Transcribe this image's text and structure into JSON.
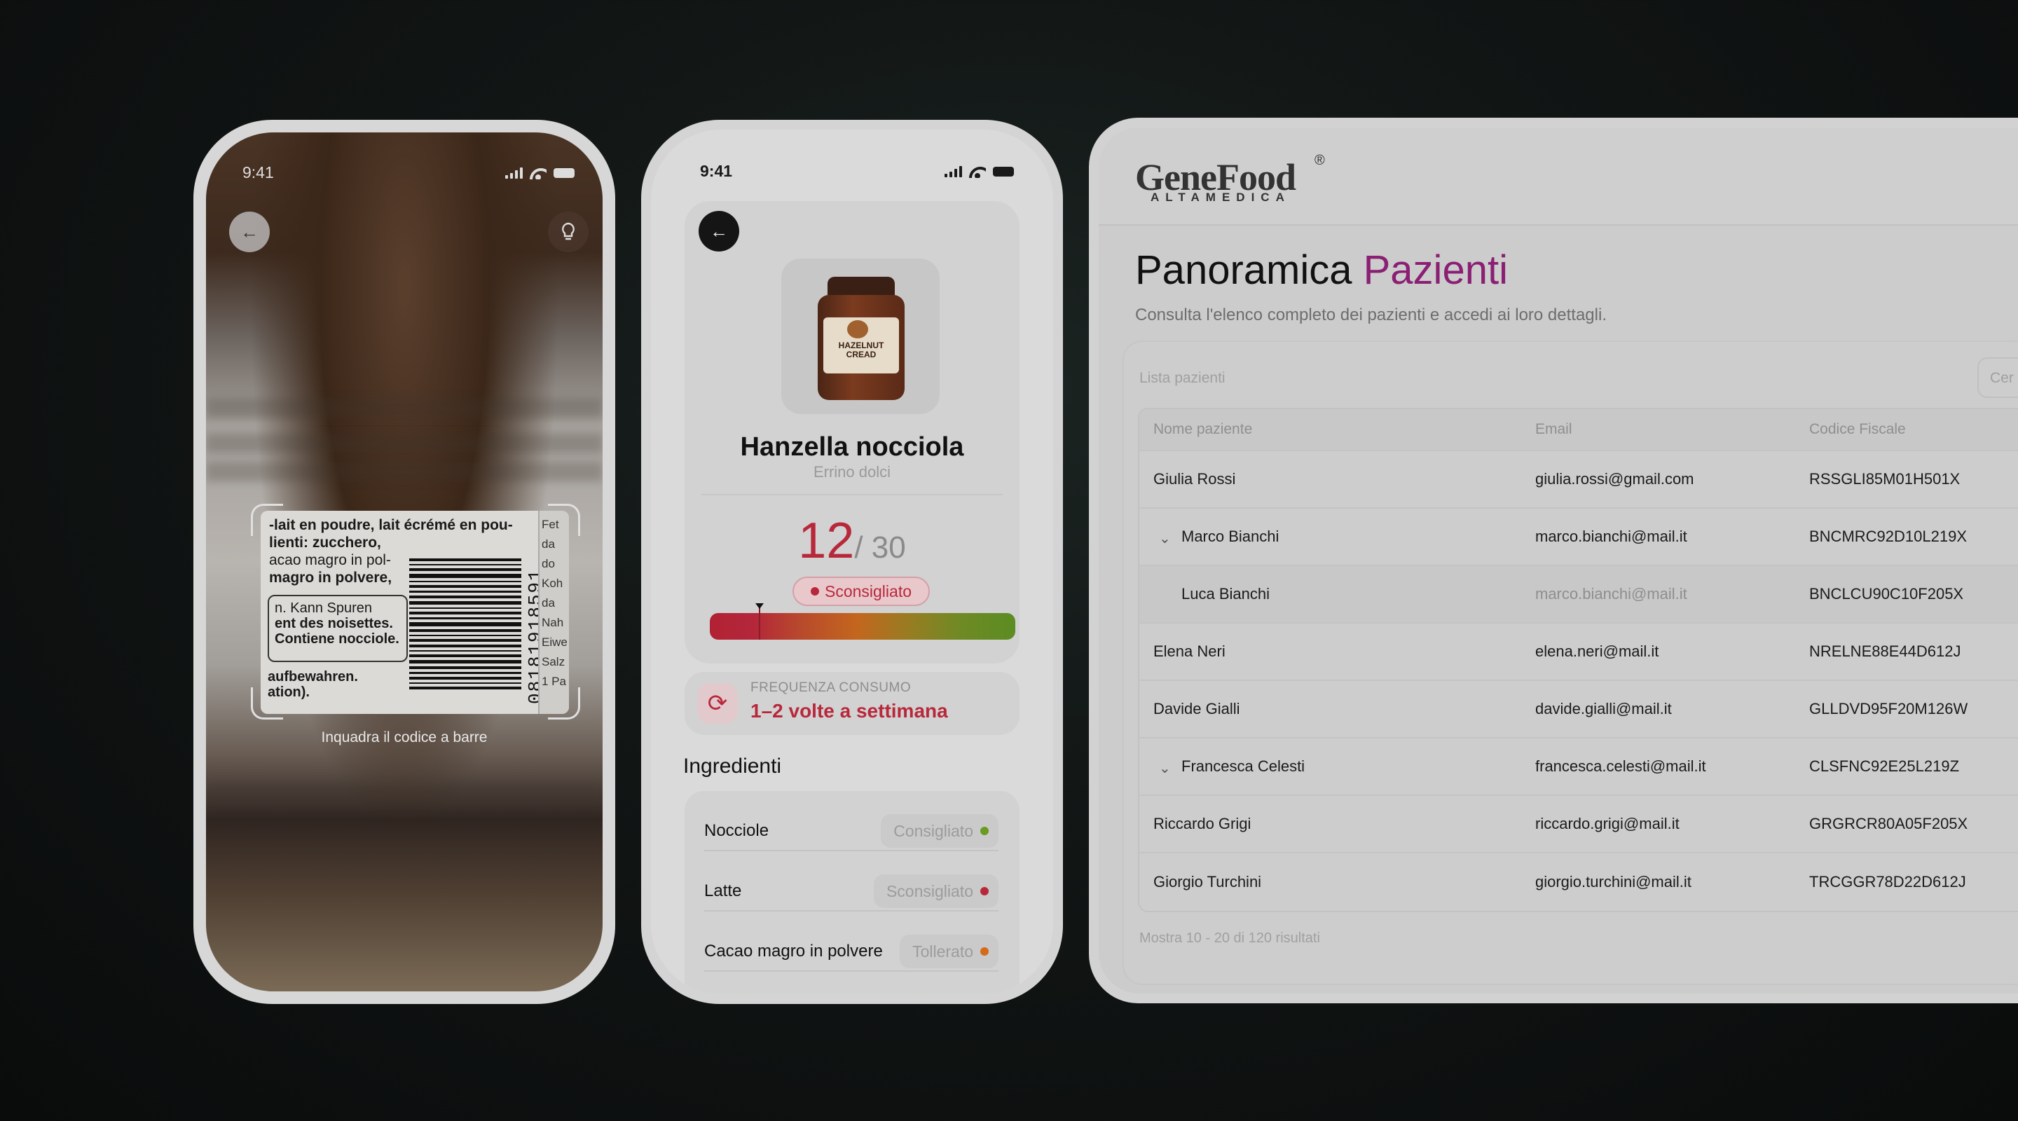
{
  "scanner": {
    "time": "9:41",
    "hint": "Inquadra il codice a barre",
    "label_lines": [
      "-lait en poudre, lait écrémé en pou-",
      "lienti: zucchero,",
      "acao magro in pol-",
      "magro in polvere,"
    ],
    "label_box_lines": [
      "n. Kann Spuren",
      "ent des noisettes.",
      "Contiene nocciole."
    ],
    "label_bottom_lines": [
      "aufbewahren.",
      "ation)."
    ],
    "barcode_number": "08181918591",
    "side_label_lines": [
      "Fet",
      "da",
      "do",
      "Koh",
      "da",
      "Nah",
      "Eiwe",
      "Salz",
      "1 Pa"
    ]
  },
  "product": {
    "time": "9:41",
    "name": "Hanzella nocciola",
    "brand": "Errino dolci",
    "jar_label": "HAZELNUT CREAD",
    "score": "12",
    "score_max": "/ 30",
    "rating": "Sconsigliato",
    "rating_color": "#b8283b",
    "frequency_label": "FREQUENZA CONSUMO",
    "frequency_value": "1–2 volte a settimana",
    "ingredients_title": "Ingredienti",
    "ingredients": [
      {
        "name": "Nocciole",
        "status": "Consigliato",
        "color": "#6a9a1f"
      },
      {
        "name": "Latte",
        "status": "Sconsigliato",
        "color": "#b8283b"
      },
      {
        "name": "Cacao magro in polvere",
        "status": "Tollerato",
        "color": "#d46a1a"
      }
    ]
  },
  "dashboard": {
    "logo": "GeneFood",
    "logo_reg": "®",
    "logo_sub": "ALTAMEDICA",
    "title_main": "Panoramica",
    "title_accent": "Pazienti",
    "accent_color": "#8a1f74",
    "subtitle": "Consulta l'elenco completo dei pazienti e accedi ai loro dettagli.",
    "list_label": "Lista pazienti",
    "search_placeholder": "Cer",
    "columns": [
      "Nome paziente",
      "Email",
      "Codice Fiscale"
    ],
    "rows": [
      {
        "name": "Giulia Rossi",
        "email": "giulia.rossi@gmail.com",
        "cf": "RSSGLI85M01H501X"
      },
      {
        "name": "Marco Bianchi",
        "email": "marco.bianchi@mail.it",
        "cf": "BNCMRC92D10L219X"
      },
      {
        "name": "Luca Bianchi",
        "email": "marco.bianchi@mail.it",
        "cf": "BNCLCU90C10F205X"
      },
      {
        "name": "Elena Neri",
        "email": "elena.neri@mail.it",
        "cf": "NRELNE88E44D612J"
      },
      {
        "name": "Davide Gialli",
        "email": "davide.gialli@mail.it",
        "cf": "GLLDVD95F20M126W"
      },
      {
        "name": "Francesca Celesti",
        "email": "francesca.celesti@mail.it",
        "cf": "CLSFNC92E25L219Z"
      },
      {
        "name": "Riccardo Grigi",
        "email": "riccardo.grigi@mail.it",
        "cf": "GRGRCR80A05F205X"
      },
      {
        "name": "Giorgio Turchini",
        "email": "giorgio.turchini@mail.it",
        "cf": "TRCGGR78D22D612J"
      }
    ],
    "footer": "Mostra 10 - 20 di 120 risultati"
  }
}
